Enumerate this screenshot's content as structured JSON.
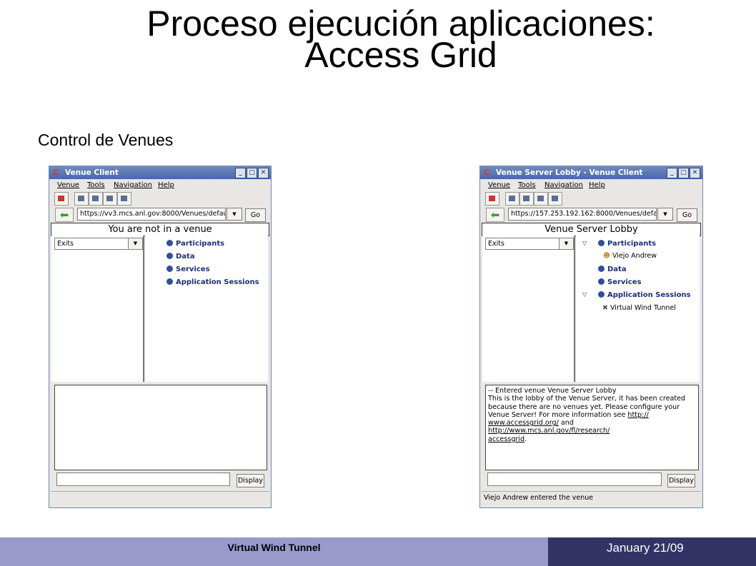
{
  "slide": {
    "title_line1": "Proceso ejecución aplicaciones:",
    "title_line2": "Access Grid",
    "subtitle": "Control de Venues"
  },
  "footer": {
    "title": "Virtual Wind Tunnel",
    "date": "January 21/09"
  },
  "window_left": {
    "title": "Venue Client",
    "menu": [
      "Venue",
      "Tools",
      "Navigation",
      "Help"
    ],
    "url": "https://vv3.mcs.anl.gov:8000/Venues/defau",
    "go_label": "Go",
    "venue_name": "You are not in a venue",
    "exits_label": "Exits",
    "tree": [
      "Participants",
      "Data",
      "Services",
      "Application Sessions"
    ],
    "display_label": "Display",
    "status": ""
  },
  "window_right": {
    "title": "Venue Server Lobby - Venue Client",
    "menu": [
      "Venue",
      "Tools",
      "Navigation",
      "Help"
    ],
    "url": "https://157.253.192.162:8000/Venues/defa",
    "go_label": "Go",
    "venue_name": "Venue Server Lobby",
    "exits_label": "Exits",
    "tree": {
      "participants": "Participants",
      "participant_1": "Viejo Andrew",
      "data": "Data",
      "services": "Services",
      "app_sessions": "Application Sessions",
      "app_1": "Virtual Wind Tunnel"
    },
    "log": {
      "line1": "-- Entered venue Venue Server Lobby",
      "line2": "This is the lobby of the Venue Server, it has been created",
      "line3": "because there are no venues yet. Please configure your",
      "line4_a": "Venue Server! For more information see ",
      "link1_a": "http://",
      "link1_b": "www.accessgrid.org/",
      "and": " and ",
      "link2_a": "http://www.mcs.anl.gov/fl/research/",
      "link2_b": "accessgrid",
      "end": "."
    },
    "display_label": "Display",
    "status": "Viejo Andrew entered the venue"
  },
  "colors": {
    "titlebar": "#5677b5",
    "tree_text": "#1c2f7a",
    "footer_left": "#9a99cc",
    "footer_right": "#333366"
  }
}
